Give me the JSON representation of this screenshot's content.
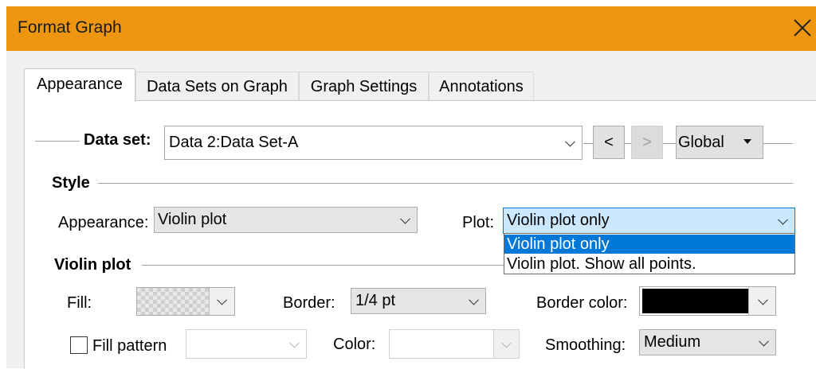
{
  "window": {
    "title": "Format Graph"
  },
  "tabs": [
    "Appearance",
    "Data Sets on Graph",
    "Graph Settings",
    "Annotations"
  ],
  "dataset": {
    "label": "Data set:",
    "value": "Data 2:Data Set-A",
    "prev_label": "<",
    "next_label": ">",
    "scope_value": "Global"
  },
  "style": {
    "heading": "Style",
    "appearance_label": "Appearance:",
    "appearance_value": "Violin plot",
    "plot_label": "Plot:",
    "plot_value": "Violin plot only",
    "plot_options": [
      "Violin plot only",
      "Violin plot. Show all points."
    ]
  },
  "violin": {
    "heading": "Violin plot",
    "fill_label": "Fill:",
    "border_label": "Border:",
    "border_value": "1/4 pt",
    "border_color_label": "Border color:",
    "border_color": "#000000",
    "fill_pattern_label": "Fill pattern",
    "fill_pattern_value": "",
    "color_label": "Color:",
    "smoothing_label": "Smoothing:",
    "smoothing_value": "Medium"
  },
  "colors": {
    "titlebar": "#ee960f",
    "selection": "#0078d7",
    "dropdown_highlight": "#cce8ff"
  }
}
